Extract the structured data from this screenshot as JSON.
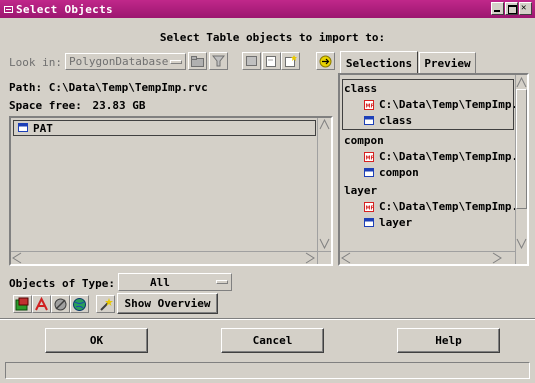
{
  "window": {
    "title": "Select Objects"
  },
  "heading": "Select Table objects to import to:",
  "lookin": {
    "label": "Look in:",
    "value": "PolygonDatabase"
  },
  "path": {
    "label": "Path:",
    "value": "C:\\Data\\Temp\\TempImp.rvc"
  },
  "space": {
    "label": "Space free:",
    "value": "23.83 GB"
  },
  "list_items": [
    {
      "label": "PAT",
      "icon": "table-icon"
    }
  ],
  "tabs": [
    {
      "label": "Selections"
    },
    {
      "label": "Preview"
    }
  ],
  "selections": {
    "groups": [
      {
        "name": "class",
        "file": "C:\\Data\\Temp\\TempImp.r",
        "object": "class"
      },
      {
        "name": "compon",
        "file": "C:\\Data\\Temp\\TempImp.r",
        "object": "compon"
      },
      {
        "name": "layer",
        "file": "C:\\Data\\Temp\\TempImp.r",
        "object": "layer"
      }
    ]
  },
  "objects_type": {
    "label": "Objects of Type:",
    "value": "All"
  },
  "buttons": {
    "show_overview": "Show Overview",
    "ok": "OK",
    "cancel": "Cancel",
    "help": "Help"
  },
  "colors": {
    "titlebar": "#b01e7e",
    "face": "#d4d0c8",
    "table_icon": "#1c3fb7",
    "file_icon_red": "#d62020"
  }
}
